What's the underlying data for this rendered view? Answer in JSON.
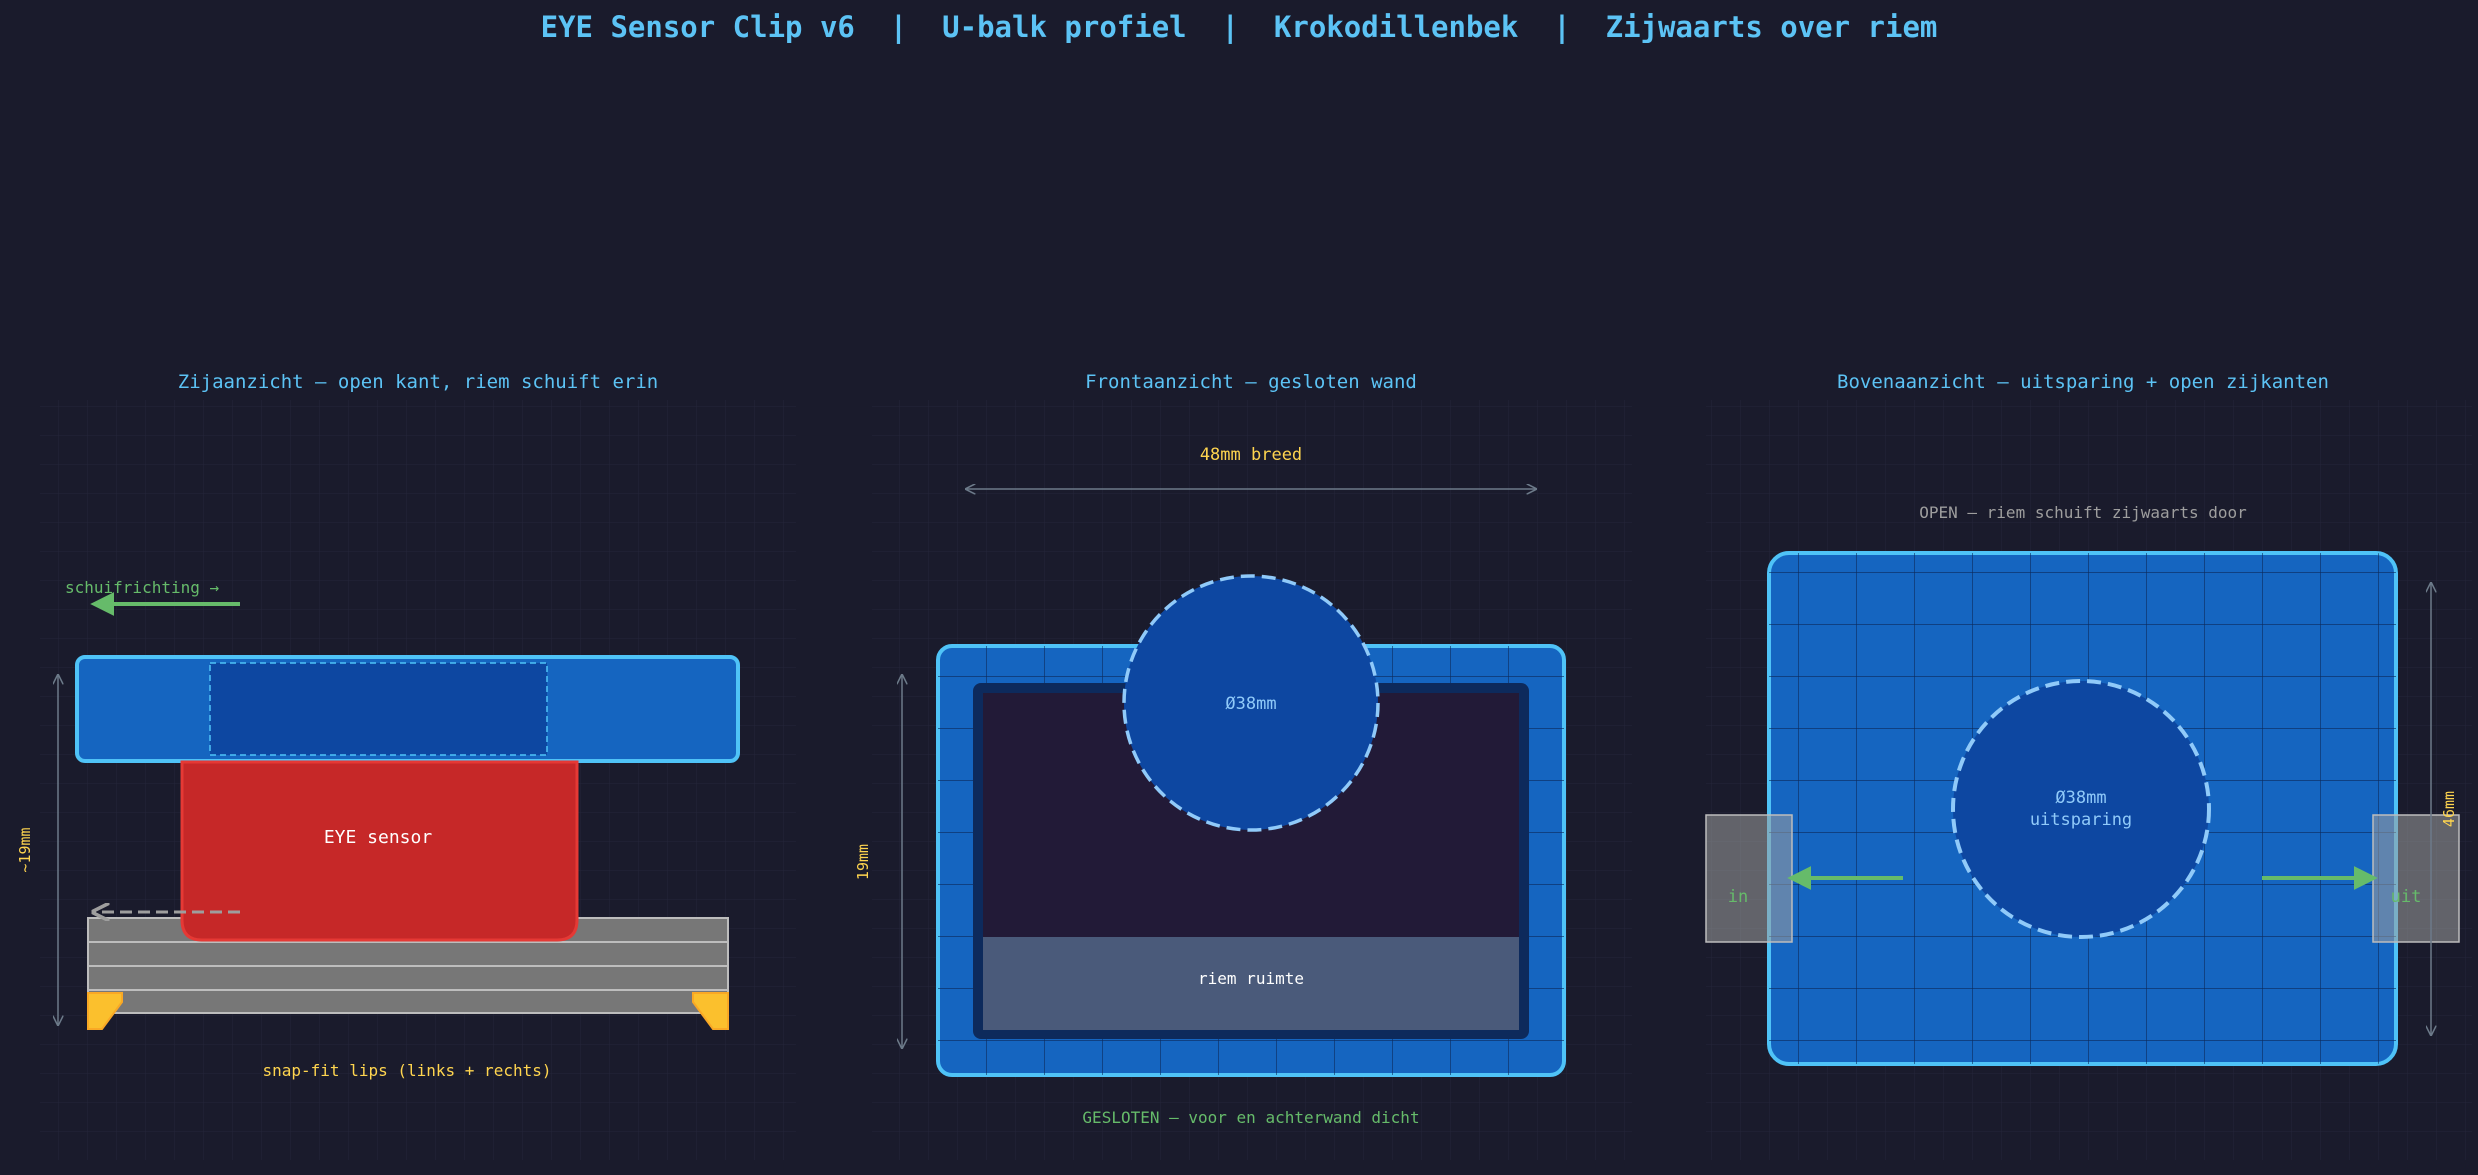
{
  "title": "EYE Sensor Clip v6  |  U-balk profiel  |  Krokodillenbek  |  Zijwaarts over riem",
  "panels": {
    "side": {
      "title": "Zijaanzicht — open kant, riem schuift erin",
      "direction_label": "schuifrichting →",
      "sensor_label": "EYE sensor",
      "height_label": "~19mm",
      "lips_label": "snap-fit lips (links + rechts)"
    },
    "front": {
      "title": "Frontaanzicht — gesloten wand",
      "width_label": "48mm breed",
      "height_label": "19mm",
      "circle_label": "Ø38mm",
      "belt_label": "riem ruimte",
      "footer_label": "GESLOTEN — voor en achterwand dicht"
    },
    "top": {
      "title": "Bovenaanzicht — uitsparing + open zijkanten",
      "open_label": "OPEN — riem schuift zijwaarts door",
      "circle_label_1": "Ø38mm",
      "circle_label_2": "uitsparing",
      "in_label": "in",
      "out_label": "uit",
      "height_label": "46mm"
    }
  },
  "colors": {
    "background": "#1a1b2c",
    "title": "#5cc3f5",
    "blue_fill": "#1565c0",
    "blue_stroke": "#4fc3f7",
    "dark_blue": "#0d47a1",
    "sensor_red": "#c62828",
    "accent_yellow": "#fbc02d",
    "label_yellow": "#ffd54f",
    "green": "#66bb6a",
    "grey": "#9e9e9e"
  }
}
